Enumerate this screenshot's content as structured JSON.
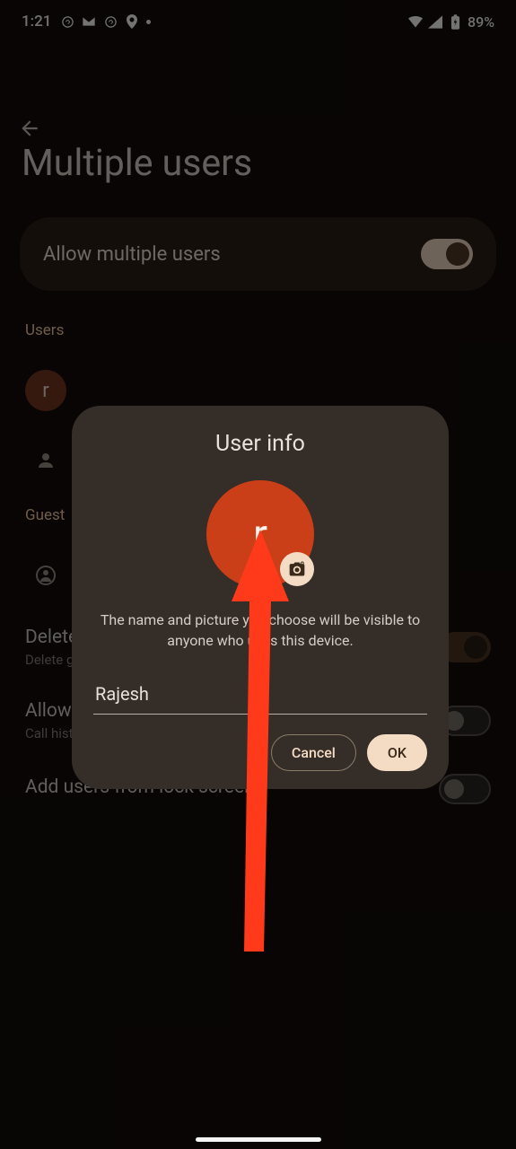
{
  "status": {
    "time": "1:21",
    "battery": "89%"
  },
  "page": {
    "title": "Multiple users",
    "allow_card": {
      "label": "Allow multiple users"
    },
    "users_header": "Users",
    "users": [
      {
        "initial": "r"
      }
    ],
    "guest_header": "Guest",
    "settings": [
      {
        "title": "Delete guest activity",
        "sub": "Delete guest apps and data on session end"
      },
      {
        "title": "Allow guest to make calls",
        "sub": "Call history will be shared with guest user"
      },
      {
        "title": "Add users from lock screen",
        "sub": ""
      }
    ]
  },
  "dialog": {
    "title": "User info",
    "avatar_initial": "r",
    "description": "The name and picture you choose will be visible to anyone who uses this device.",
    "name_value": "Rajesh",
    "cancel": "Cancel",
    "ok": "OK"
  }
}
